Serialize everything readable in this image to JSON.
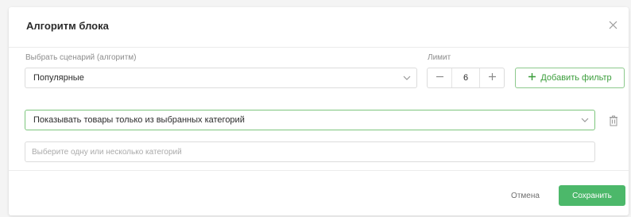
{
  "dialog": {
    "title": "Алгоритм блока",
    "close_icon": "close-icon"
  },
  "scenario": {
    "label": "Выбрать сценарий (алгоритм)",
    "value": "Популярные"
  },
  "limit": {
    "label": "Лимит",
    "value": "6",
    "decrement_icon": "minus-icon",
    "increment_icon": "plus-icon"
  },
  "add_filter": {
    "label": "Добавить фильтр",
    "icon": "plus-icon"
  },
  "category_filter": {
    "value": "Показывать товары только из выбранных категорий",
    "delete_icon": "trash-icon",
    "categories_placeholder": "Выберите одну или несколько категорий"
  },
  "footer": {
    "cancel_label": "Отмена",
    "save_label": "Сохранить"
  },
  "colors": {
    "accent_green": "#4cb86a",
    "green_border": "#7dc67d",
    "modal_bg": "#ffffff",
    "page_bg": "#f4f4f4"
  }
}
